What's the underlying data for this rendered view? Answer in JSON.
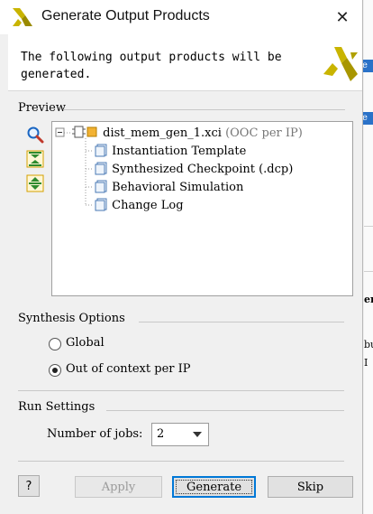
{
  "dialog": {
    "title": "Generate Output Products",
    "message": "The following output products will be generated."
  },
  "preview": {
    "label": "Preview",
    "tree": {
      "root": "dist_mem_gen_1.xci",
      "root_note": "(OOC per IP)",
      "children": [
        "Instantiation Template",
        "Synthesized Checkpoint (.dcp)",
        "Behavioral Simulation",
        "Change Log"
      ]
    },
    "tools": [
      "search-icon",
      "collapse-all-icon",
      "expand-all-icon"
    ]
  },
  "synthesis": {
    "label": "Synthesis Options",
    "options": [
      "Global",
      "Out of context per IP"
    ],
    "selected": "Out of context per IP"
  },
  "run": {
    "label": "Run Settings",
    "jobs_label": "Number of jobs:",
    "jobs_value": "2"
  },
  "buttons": {
    "help": "?",
    "apply": "Apply",
    "generate": "Generate",
    "skip": "Skip"
  },
  "colors": {
    "accent": "#0078d7",
    "logo_yellow": "#c9b400",
    "background": "#f0f0f0"
  }
}
